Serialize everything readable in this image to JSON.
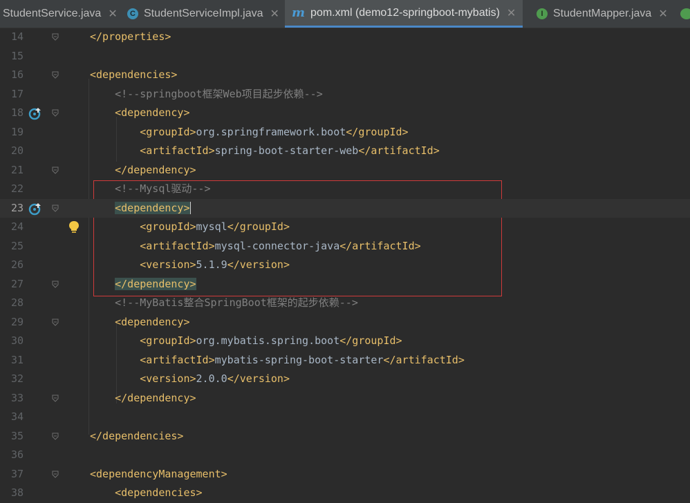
{
  "tabs": [
    {
      "label": "StudentService.java",
      "icon": "none",
      "active": false
    },
    {
      "label": "StudentServiceImpl.java",
      "icon": "class-icon",
      "active": false
    },
    {
      "label": "pom.xml (demo12-springboot-mybatis)",
      "icon": "maven-icon",
      "active": true
    },
    {
      "label": "StudentMapper.java",
      "icon": "interface-icon",
      "active": false
    }
  ],
  "icons": {
    "class_letter": "C",
    "interface_letter": "I",
    "maven_letter": "m",
    "close": "✕"
  },
  "lines": [
    {
      "n": "14",
      "segs": [
        {
          "t": "</properties>",
          "c": "tag"
        }
      ]
    },
    {
      "n": "15",
      "segs": []
    },
    {
      "n": "16",
      "segs": [
        {
          "t": "<dependencies>",
          "c": "tag"
        }
      ]
    },
    {
      "n": "17",
      "segs": [
        {
          "t": "    <!--springboot框架Web项目起步依赖-->",
          "c": "cm"
        }
      ]
    },
    {
      "n": "18",
      "segs": [
        {
          "t": "    ",
          "c": "txt"
        },
        {
          "t": "<dependency>",
          "c": "tag"
        }
      ]
    },
    {
      "n": "19",
      "segs": [
        {
          "t": "        ",
          "c": "txt"
        },
        {
          "t": "<groupId>",
          "c": "tag"
        },
        {
          "t": "org.springframework.boot",
          "c": "txt"
        },
        {
          "t": "</groupId>",
          "c": "tag"
        }
      ]
    },
    {
      "n": "20",
      "segs": [
        {
          "t": "        ",
          "c": "txt"
        },
        {
          "t": "<artifactId>",
          "c": "tag"
        },
        {
          "t": "spring-boot-starter-web",
          "c": "txt"
        },
        {
          "t": "</artifactId>",
          "c": "tag"
        }
      ]
    },
    {
      "n": "21",
      "segs": [
        {
          "t": "    ",
          "c": "txt"
        },
        {
          "t": "</dependency>",
          "c": "tag"
        }
      ]
    },
    {
      "n": "22",
      "segs": [
        {
          "t": "    <!--Mysql驱动-->",
          "c": "cm"
        }
      ]
    },
    {
      "n": "23",
      "segs": [
        {
          "t": "    ",
          "c": "txt"
        },
        {
          "t": "<dependency>",
          "c": "tag hl"
        }
      ],
      "current": true
    },
    {
      "n": "24",
      "segs": [
        {
          "t": "        ",
          "c": "txt"
        },
        {
          "t": "<groupId>",
          "c": "tag"
        },
        {
          "t": "mysql",
          "c": "txt"
        },
        {
          "t": "</groupId>",
          "c": "tag"
        }
      ]
    },
    {
      "n": "25",
      "segs": [
        {
          "t": "        ",
          "c": "txt"
        },
        {
          "t": "<artifactId>",
          "c": "tag"
        },
        {
          "t": "mysql-connector-java",
          "c": "txt"
        },
        {
          "t": "</artifactId>",
          "c": "tag"
        }
      ]
    },
    {
      "n": "26",
      "segs": [
        {
          "t": "        ",
          "c": "txt"
        },
        {
          "t": "<version>",
          "c": "tag"
        },
        {
          "t": "5.1.9",
          "c": "txt"
        },
        {
          "t": "</version>",
          "c": "tag"
        }
      ]
    },
    {
      "n": "27",
      "segs": [
        {
          "t": "    ",
          "c": "txt"
        },
        {
          "t": "</dependency>",
          "c": "tag hl"
        }
      ]
    },
    {
      "n": "28",
      "segs": [
        {
          "t": "    <!--MyBatis整合SpringBoot框架的起步依赖-->",
          "c": "cm"
        }
      ]
    },
    {
      "n": "29",
      "segs": [
        {
          "t": "    ",
          "c": "txt"
        },
        {
          "t": "<dependency>",
          "c": "tag"
        }
      ]
    },
    {
      "n": "30",
      "segs": [
        {
          "t": "        ",
          "c": "txt"
        },
        {
          "t": "<groupId>",
          "c": "tag"
        },
        {
          "t": "org.mybatis.spring.boot",
          "c": "txt"
        },
        {
          "t": "</groupId>",
          "c": "tag"
        }
      ]
    },
    {
      "n": "31",
      "segs": [
        {
          "t": "        ",
          "c": "txt"
        },
        {
          "t": "<artifactId>",
          "c": "tag"
        },
        {
          "t": "mybatis-spring-boot-starter",
          "c": "txt"
        },
        {
          "t": "</artifactId>",
          "c": "tag"
        }
      ]
    },
    {
      "n": "32",
      "segs": [
        {
          "t": "        ",
          "c": "txt"
        },
        {
          "t": "<version>",
          "c": "tag"
        },
        {
          "t": "2.0.0",
          "c": "txt"
        },
        {
          "t": "</version>",
          "c": "tag"
        }
      ]
    },
    {
      "n": "33",
      "segs": [
        {
          "t": "    ",
          "c": "txt"
        },
        {
          "t": "</dependency>",
          "c": "tag"
        }
      ]
    },
    {
      "n": "34",
      "segs": []
    },
    {
      "n": "35",
      "segs": [
        {
          "t": "</dependencies>",
          "c": "tag"
        }
      ]
    },
    {
      "n": "36",
      "segs": []
    },
    {
      "n": "37",
      "segs": [
        {
          "t": "<dependencyManagement>",
          "c": "tag"
        }
      ]
    },
    {
      "n": "38",
      "segs": [
        {
          "t": "    ",
          "c": "txt"
        },
        {
          "t": "<dependencies>",
          "c": "tag"
        }
      ]
    }
  ],
  "gutter": {
    "fold_lines": [
      "14",
      "16",
      "18",
      "21",
      "23",
      "27",
      "29",
      "33",
      "35",
      "37"
    ],
    "run_icon_lines": [
      "18",
      "23"
    ],
    "bulb_line": "24"
  },
  "colors": {
    "background": "#2b2b2b",
    "tag": "#e8bf6a",
    "text": "#a9b7c6",
    "comment": "#808080",
    "highlight_box": "#d03a3a",
    "active_tab_underline": "#4a88c7"
  }
}
